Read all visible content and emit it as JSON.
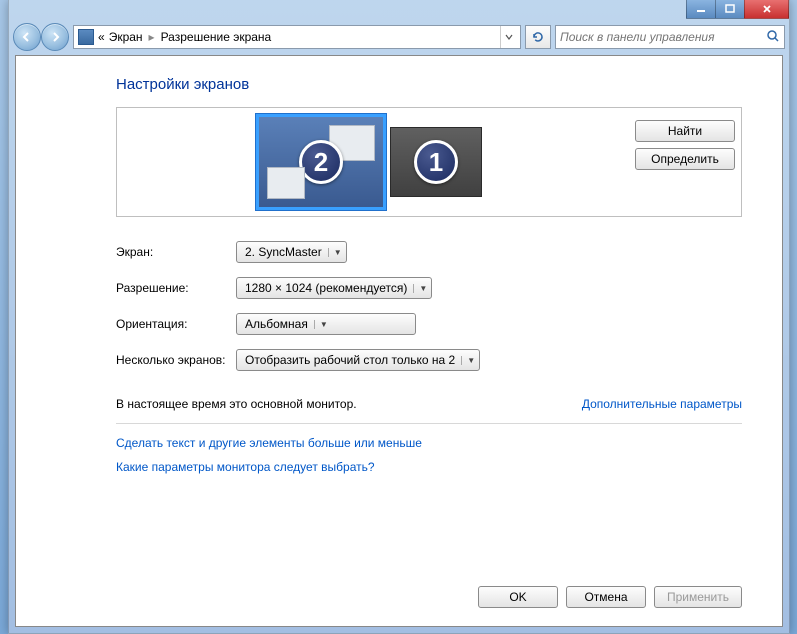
{
  "breadcrumb": {
    "laquo": "«",
    "part1": "Экран",
    "part2": "Разрешение экрана"
  },
  "search": {
    "placeholder": "Поиск в панели управления"
  },
  "page": {
    "title": "Настройки экранов"
  },
  "monitors": {
    "primary_num": "2",
    "secondary_num": "1"
  },
  "preview_buttons": {
    "find": "Найти",
    "identify": "Определить"
  },
  "form": {
    "display_label": "Экран:",
    "display_value": "2. SyncMaster",
    "resolution_label": "Разрешение:",
    "resolution_value": "1280 × 1024 (рекомендуется)",
    "orientation_label": "Ориентация:",
    "orientation_value": "Альбомная",
    "multi_label": "Несколько экранов:",
    "multi_value": "Отобразить рабочий стол только на 2"
  },
  "status": {
    "text": "В настоящее время это основной монитор.",
    "advanced_link": "Дополнительные параметры"
  },
  "links": {
    "text_size": "Сделать текст и другие элементы больше или меньше",
    "which_settings": "Какие параметры монитора следует выбрать?"
  },
  "footer": {
    "ok": "OK",
    "cancel": "Отмена",
    "apply": "Применить"
  }
}
